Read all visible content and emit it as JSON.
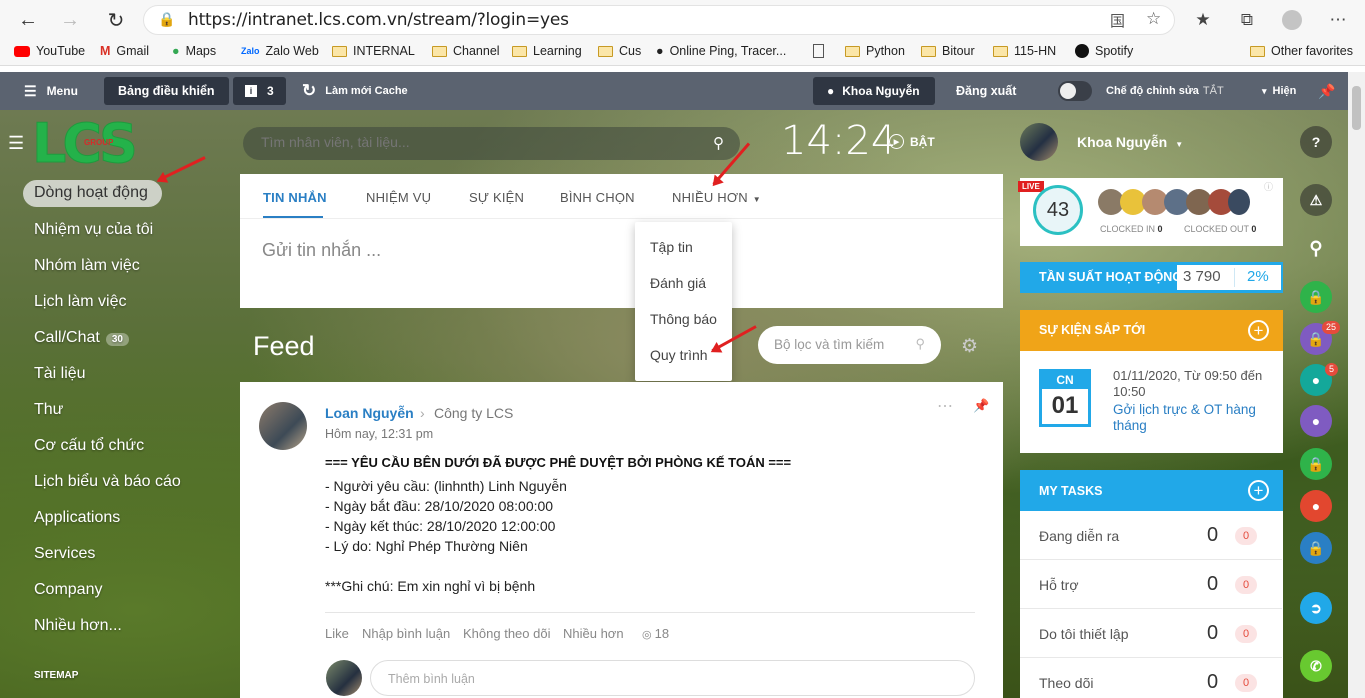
{
  "browser": {
    "url": "https://intranet.lcs.com.vn/stream/?login=yes",
    "bookmarks": [
      "YouTube",
      "Gmail",
      "Maps",
      "Zalo Web",
      "INTERNAL",
      "Channel",
      "Learning",
      "Cus",
      "Online Ping, Tracer...",
      "Python",
      "Bitour",
      "115-HN",
      "Spotify",
      "Other favorites"
    ]
  },
  "topbar": {
    "menu_label": "Menu",
    "dashboard_label": "Bảng điều khiển",
    "notif_count": "3",
    "refresh_cache_label": "Làm mới Cache",
    "user_label": "Khoa Nguyễn",
    "logout_label": "Đăng xuất",
    "edit_mode_label": "Chế độ chỉnh sửa",
    "edit_mode_state": "TẮT",
    "show_label": "Hiện"
  },
  "logo": {
    "text": "LCS",
    "sub": "GROUP"
  },
  "sidebar": {
    "items": [
      {
        "label": "Dòng hoạt động"
      },
      {
        "label": "Nhiệm vụ của tôi"
      },
      {
        "label": "Nhóm làm việc"
      },
      {
        "label": "Lịch làm việc"
      },
      {
        "label": "Call/Chat",
        "badge": "30"
      },
      {
        "label": "Tài liệu"
      },
      {
        "label": "Thư"
      },
      {
        "label": "Cơ cấu tổ chức"
      },
      {
        "label": "Lịch biểu và báo cáo"
      },
      {
        "label": "Applications"
      },
      {
        "label": "Services"
      },
      {
        "label": "Company"
      },
      {
        "label": "Nhiều hơn..."
      }
    ],
    "sitemap_label": "SITEMAP"
  },
  "search": {
    "placeholder": "Tìm nhân viên, tài liệu..."
  },
  "clock": {
    "time": "14:24",
    "toggle_label": "BẬT"
  },
  "composer": {
    "tabs": [
      "TIN NHẮN",
      "NHIỆM VỤ",
      "SỰ KIỆN",
      "BÌNH CHỌN",
      "NHIỀU HƠN"
    ],
    "placeholder": "Gửi tin nhắn ...",
    "dropdown": [
      "Tập tin",
      "Đánh giá",
      "Thông báo",
      "Quy trình"
    ]
  },
  "feed": {
    "title": "Feed",
    "filter_placeholder": "Bộ lọc và tìm kiếm",
    "post": {
      "author": "Loan Nguyễn",
      "target": "Công ty LCS",
      "time": "Hôm nay, 12:31 pm",
      "heading": "=== YÊU CẦU BÊN DƯỚI ĐÃ ĐƯỢC PHÊ DUYỆT BỞI PHÒNG KẾ TOÁN ===",
      "lines": [
        "- Người yêu cầu: (linhnth) Linh Nguyễn",
        "- Ngày bắt đầu: 28/10/2020 08:00:00",
        "- Ngày kết thúc: 28/10/2020 12:00:00",
        "- Lý do: Nghỉ Phép Thường Niên"
      ],
      "note": "***Ghi chú: Em xin nghỉ vì bị bệnh",
      "actions": [
        "Like",
        "Nhập bình luận",
        "Không theo dõi",
        "Nhiều hơn"
      ],
      "views": "18",
      "comment_placeholder": "Thêm bình luận"
    }
  },
  "profile": {
    "name": "Khoa Nguyễn",
    "live_label": "LIVE",
    "live_count": "43",
    "clocked_in_label": "CLOCKED IN",
    "clocked_in": "0",
    "clocked_out_label": "CLOCKED OUT",
    "clocked_out": "0"
  },
  "activity": {
    "label": "TẦN SUẤT HOẠT ĐỘNG",
    "value": "3 790",
    "percent": "2%"
  },
  "events": {
    "title": "SỰ KIỆN SẮP TỚI",
    "day_name": "CN",
    "day_num": "01",
    "datetime": "01/11/2020, Từ 09:50 đến 10:50",
    "name": "Gởi lịch trực & OT hàng tháng"
  },
  "tasks": {
    "title": "MY TASKS",
    "rows": [
      {
        "label": "Đang diễn ra",
        "count": "0",
        "badge": "0"
      },
      {
        "label": "Hỗ trợ",
        "count": "0",
        "badge": "0"
      },
      {
        "label": "Do tôi thiết lập",
        "count": "0",
        "badge": "0"
      },
      {
        "label": "Theo dõi",
        "count": "0",
        "badge": "0"
      }
    ]
  },
  "right_badges": {
    "b1": "25",
    "b2": "5"
  },
  "colors": {
    "accent_blue": "#2a7fc4",
    "event_orange": "#f0a418",
    "task_blue": "#21a8e8",
    "green": "#2fb34a"
  }
}
